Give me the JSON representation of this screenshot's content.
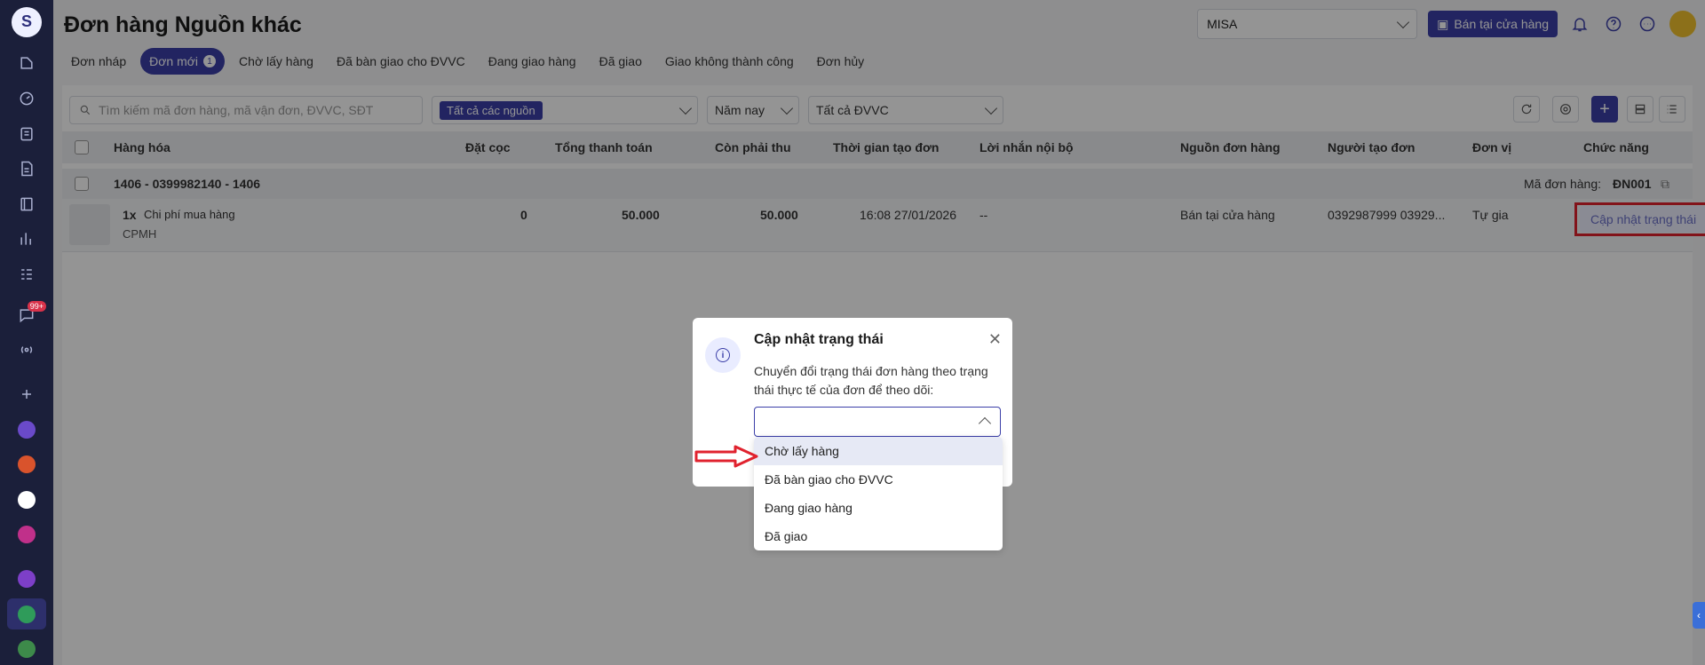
{
  "page": {
    "title": "Đơn hàng Nguồn khác"
  },
  "topbar": {
    "store_select": "MISA",
    "store_button": "Bán tại cửa hàng"
  },
  "rail": {
    "badge": "99+"
  },
  "tabs": [
    {
      "label": "Đơn nháp"
    },
    {
      "label": "Đơn mới",
      "count": "1"
    },
    {
      "label": "Chờ lấy hàng"
    },
    {
      "label": "Đã bàn giao cho ĐVVC"
    },
    {
      "label": "Đang giao hàng"
    },
    {
      "label": "Đã giao"
    },
    {
      "label": "Giao không thành công"
    },
    {
      "label": "Đơn hủy"
    }
  ],
  "filters": {
    "search_placeholder": "Tìm kiếm mã đơn hàng, mã vận đơn, ĐVVC, SĐT",
    "source_chip": "Tất cả các nguồn",
    "period": "Năm nay",
    "carrier": "Tất cả ĐVVC"
  },
  "table": {
    "headers": {
      "product": "Hàng hóa",
      "deposit": "Đặt cọc",
      "total": "Tổng thanh toán",
      "remaining": "Còn phải thu",
      "created": "Thời gian tạo đơn",
      "note": "Lời nhắn nội bộ",
      "source": "Nguồn đơn hàng",
      "creator": "Người tạo đơn",
      "unit": "Đơn vị",
      "action": "Chức năng"
    },
    "group": {
      "label": "1406 - 0399982140 - 1406",
      "order_code_label": "Mã đơn hàng:",
      "order_code": "ĐN001"
    },
    "row": {
      "qty": "1x",
      "product_name": "Chi phí mua hàng",
      "product_code": "CPMH",
      "deposit": "0",
      "total": "50.000",
      "remaining": "50.000",
      "created": "16:08 27/01/2026",
      "note": "--",
      "source": "Bán tại cửa hàng",
      "creator": "0392987999 03929...",
      "unit": "Tự gia",
      "action_label": "Cập nhật trạng thái"
    }
  },
  "dialog": {
    "title": "Cập nhật trạng thái",
    "description": "Chuyển đổi trạng thái đơn hàng theo trạng thái thực tế của đơn để theo dõi:",
    "options": [
      {
        "label": "Chờ lấy hàng"
      },
      {
        "label": "Đã bàn giao cho ĐVVC"
      },
      {
        "label": "Đang giao hàng"
      },
      {
        "label": "Đã giao"
      }
    ]
  },
  "colors": {
    "accent": "#3b3fa8",
    "rail": "#1b1f3a",
    "highlight": "#e0222e"
  }
}
